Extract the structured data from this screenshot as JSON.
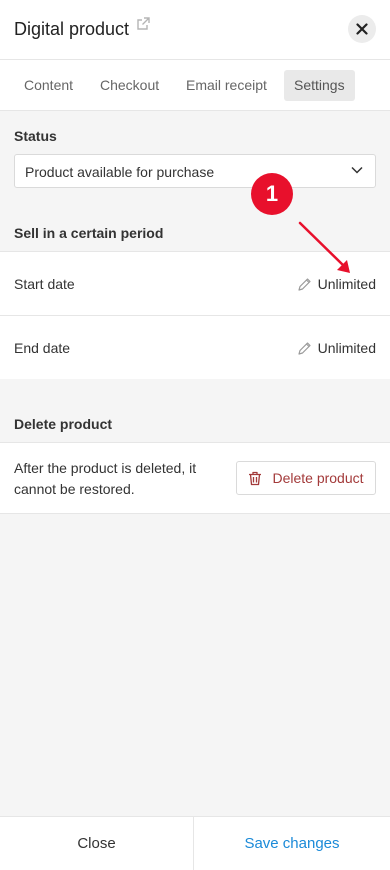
{
  "header": {
    "title": "Digital product"
  },
  "tabs": [
    {
      "label": "Content"
    },
    {
      "label": "Checkout"
    },
    {
      "label": "Email receipt"
    },
    {
      "label": "Settings",
      "active": true
    }
  ],
  "status": {
    "heading": "Status",
    "selected": "Product available for purchase"
  },
  "period": {
    "heading": "Sell in a certain period",
    "start_label": "Start date",
    "start_value": "Unlimited",
    "end_label": "End date",
    "end_value": "Unlimited"
  },
  "delete": {
    "heading": "Delete product",
    "description": "After the product is deleted, it cannot be restored.",
    "button_label": "Delete product"
  },
  "annotation": {
    "number": "1",
    "color": "#e8102c"
  },
  "footer": {
    "close_label": "Close",
    "save_label": "Save changes"
  },
  "colors": {
    "accent": "#1b8ad8",
    "danger": "#a33a3a"
  }
}
